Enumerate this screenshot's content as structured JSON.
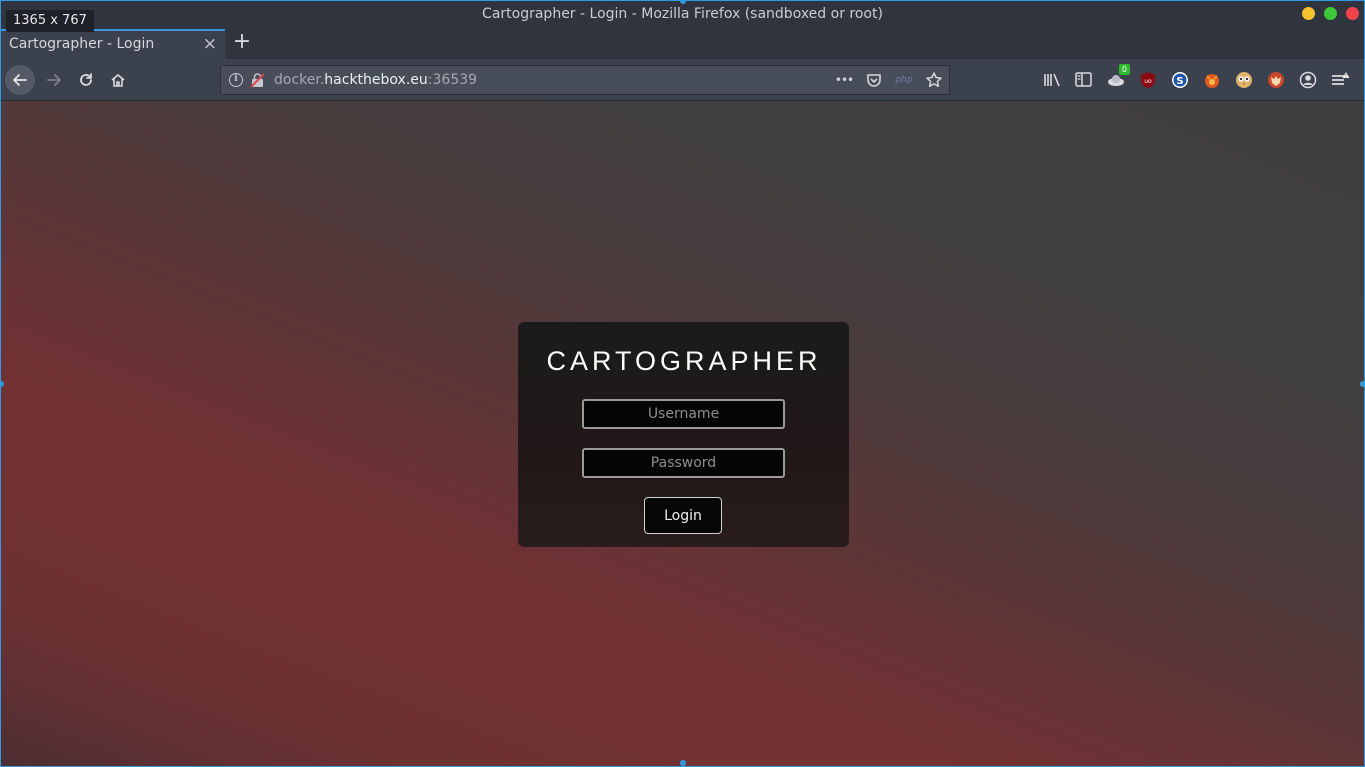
{
  "window": {
    "title": "Cartographer - Login - Mozilla Firefox (sandboxed or root)",
    "size_badge": "1365 x 767",
    "controls": {
      "minimize_color": "#f6c230",
      "maximize_color": "#3ec938",
      "close_color": "#f0424b"
    }
  },
  "tabs": [
    {
      "label": "Cartographer - Login",
      "close_label": "×",
      "active": true
    }
  ],
  "new_tab_label": "+",
  "navbar": {
    "url_prefix": "docker.",
    "url_domain": "hackthebox.eu",
    "url_port": ":36539",
    "more_label": "•••",
    "page_action_label": "php"
  },
  "toolbar": {
    "badge_count": "0",
    "icons": [
      "library-icon",
      "sidebar-icon",
      "extension-badge-icon",
      "ublock-icon",
      "s-extension-icon",
      "fox-extension-icon",
      "owl-extension-icon",
      "wolf-extension-icon",
      "account-icon",
      "menu-icon"
    ]
  },
  "login": {
    "brand": "CARTOGRAPHER",
    "username_placeholder": "Username",
    "password_placeholder": "Password",
    "submit_label": "Login"
  },
  "colors": {
    "accent": "#3d8fd6",
    "card_bg": "#1b1b1b",
    "bg_red": "#733034",
    "bg_grey": "#3e3e3e"
  }
}
